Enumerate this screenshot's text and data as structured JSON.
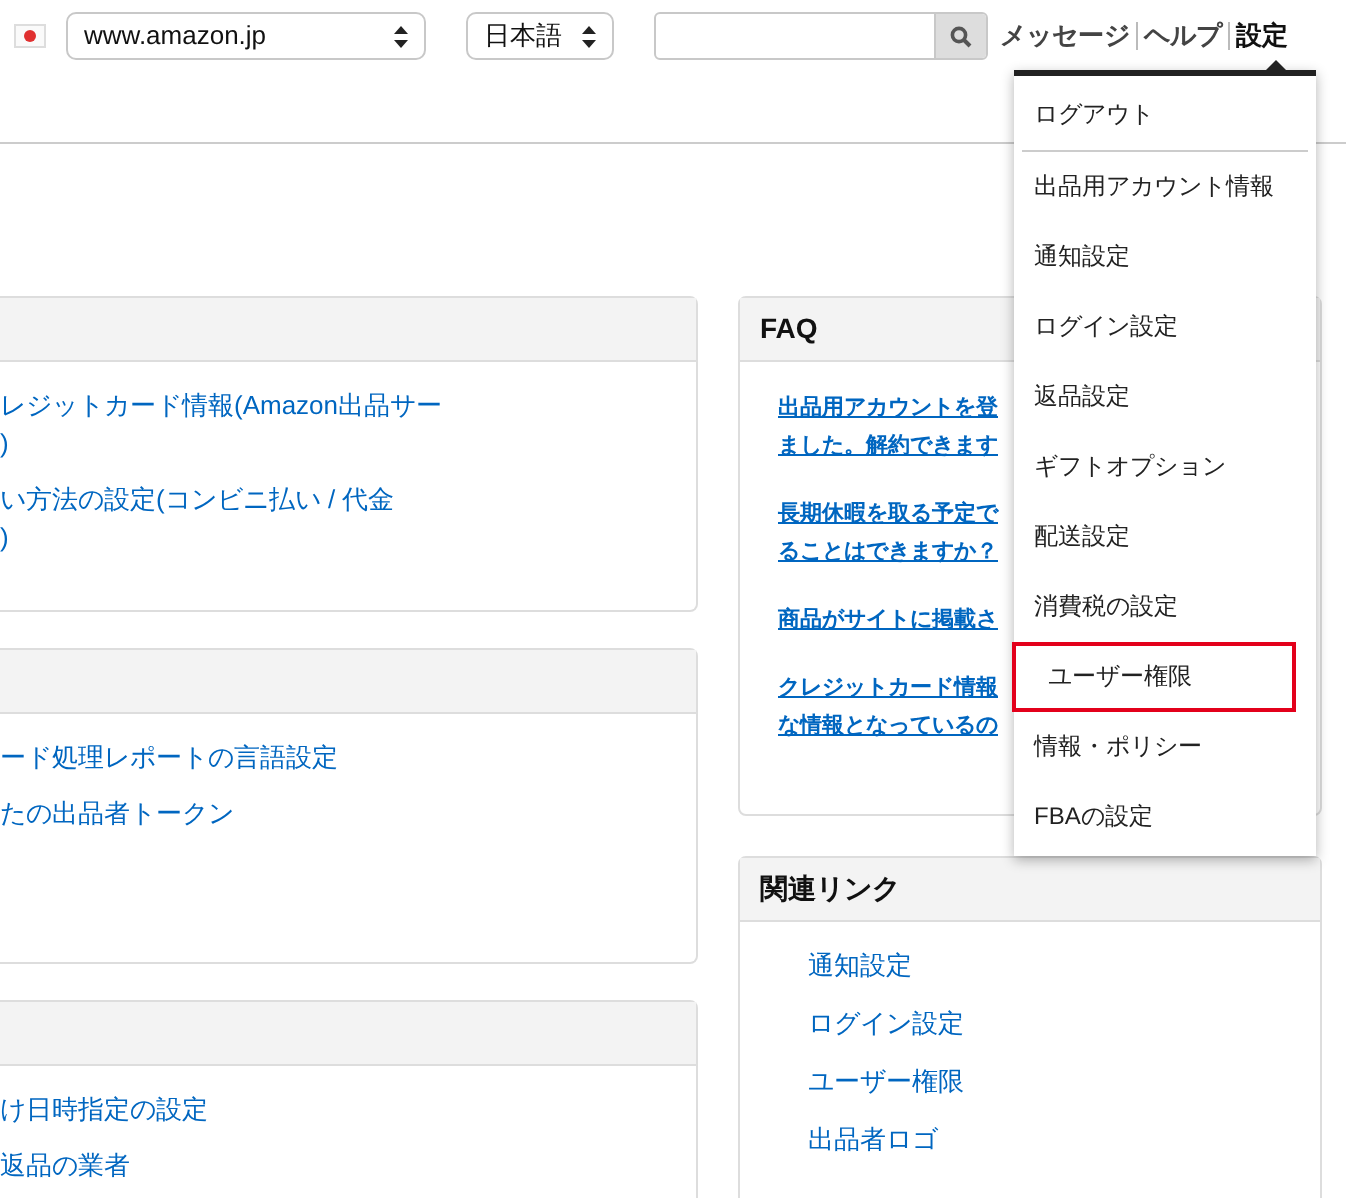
{
  "header": {
    "marketplace_select": {
      "value": "www.amazon.jp"
    },
    "language_select": {
      "value": "日本語"
    },
    "nav_links": [
      {
        "label": "メッセージ",
        "selected": false
      },
      {
        "label": "ヘルプ",
        "selected": false
      },
      {
        "label": "設定",
        "selected": true
      }
    ]
  },
  "settings_menu": {
    "items": [
      {
        "label": "ログアウト",
        "highlighted": false
      },
      {
        "label": "出品用アカウント情報",
        "highlighted": false
      },
      {
        "label": "通知設定",
        "highlighted": false
      },
      {
        "label": "ログイン設定",
        "highlighted": false
      },
      {
        "label": "返品設定",
        "highlighted": false
      },
      {
        "label": "ギフトオプション",
        "highlighted": false
      },
      {
        "label": "配送設定",
        "highlighted": false
      },
      {
        "label": "消費税の設定",
        "highlighted": false
      },
      {
        "label": "ユーザー権限",
        "highlighted": true
      },
      {
        "label": "情報・ポリシー",
        "highlighted": false
      },
      {
        "label": "FBAの設定",
        "highlighted": false
      }
    ]
  },
  "left_cards": [
    {
      "links": [
        [
          "レジットカード情報(Amazon出品サー",
          ")"
        ],
        [
          "い方法の設定(コンビニ払い / 代金",
          ")"
        ]
      ]
    },
    {
      "links": [
        [
          "ード処理レポートの言語設定"
        ],
        [
          "たの出品者トークン"
        ]
      ]
    },
    {
      "links": [
        [
          "け日時指定の設定"
        ],
        [
          "返品の業者"
        ]
      ]
    }
  ],
  "faq": {
    "title": "FAQ",
    "links": [
      [
        "出品用アカウントを登",
        "ました。解約できます"
      ],
      [
        "長期休暇を取る予定で",
        "ることはできますか？"
      ],
      [
        "商品がサイトに掲載さ"
      ],
      [
        "クレジットカード情報",
        "な情報となっているの"
      ]
    ]
  },
  "related_links": {
    "title": "関連リンク",
    "links": [
      "通知設定",
      "ログイン設定",
      "ユーザー権限",
      "出品者ロゴ"
    ]
  }
}
